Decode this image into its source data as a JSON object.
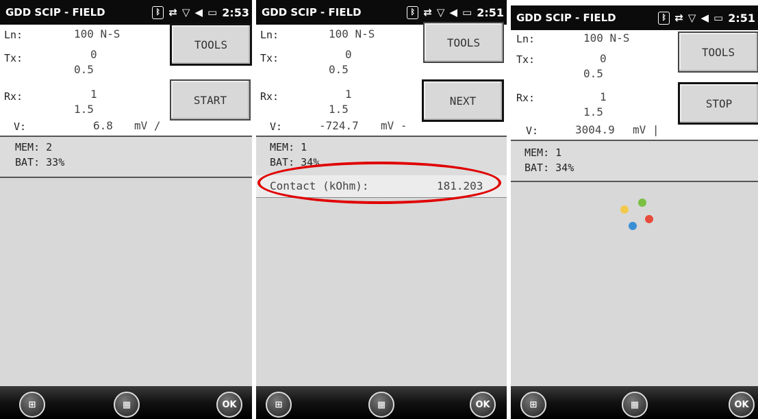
{
  "colors": {
    "titlebar": "#0b0b0b",
    "highlight": "#e00000",
    "panel": "#dcdcdc"
  },
  "icons": [
    "bluetooth-icon",
    "sync-icon",
    "no-signal-icon",
    "speaker-icon",
    "battery-icon",
    "windows-start-icon",
    "keyboard-icon",
    "ok-icon"
  ],
  "screens": [
    {
      "title": "GDD SCIP - FIELD",
      "time": "2:53",
      "ln_label": "Ln:",
      "ln_value": "100 N-S",
      "tx_label": "Tx:",
      "tx_value1": "0",
      "tx_value2": "0.5",
      "rx_label": "Rx:",
      "rx_value1": "1",
      "rx_value2": "1.5",
      "v_label": "V:",
      "v_value": "6.8",
      "v_unit": "mV /",
      "tools_button": "TOOLS",
      "action_button": "START",
      "mem": "MEM: 2",
      "bat": "BAT: 33%"
    },
    {
      "title": "GDD SCIP - FIELD",
      "time": "2:51",
      "ln_label": "Ln:",
      "ln_value": "100 N-S",
      "tx_label": "Tx:",
      "tx_value1": "0",
      "tx_value2": "0.5",
      "rx_label": "Rx:",
      "rx_value1": "1",
      "rx_value2": "1.5",
      "v_label": "V:",
      "v_value": "-724.7",
      "v_unit": "mV -",
      "tools_button": "TOOLS",
      "action_button": "NEXT",
      "mem": "MEM: 1",
      "bat": "BAT: 34%",
      "contact_label": "Contact (kOhm):",
      "contact_value": "181.203"
    },
    {
      "title": "GDD SCIP - FIELD",
      "time": "2:51",
      "ln_label": "Ln:",
      "ln_value": "100 N-S",
      "tx_label": "Tx:",
      "tx_value1": "0",
      "tx_value2": "0.5",
      "rx_label": "Rx:",
      "rx_value1": "1",
      "rx_value2": "1.5",
      "v_label": "V:",
      "v_value": "3004.9",
      "v_unit": "mV |",
      "tools_button": "TOOLS",
      "action_button": "STOP",
      "mem": "MEM: 1",
      "bat": "BAT: 34%"
    }
  ],
  "taskbar": {
    "ok_label": "OK"
  }
}
